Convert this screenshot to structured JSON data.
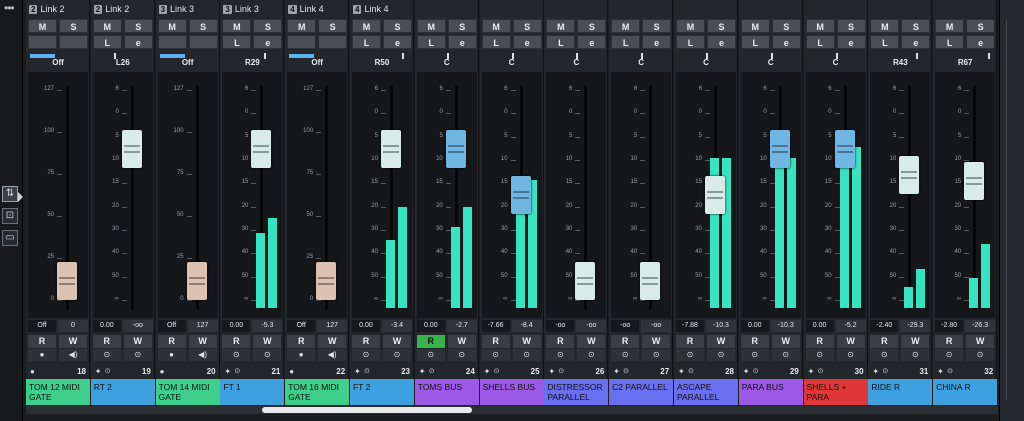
{
  "left_toolbar": {
    "menu_icon": "more-icon",
    "buttons": [
      {
        "icon": "mixer-faders-icon",
        "glyph": "⇅",
        "active": true
      },
      {
        "icon": "inserts-icon",
        "glyph": "⊡",
        "active": false
      },
      {
        "icon": "monitor-icon",
        "glyph": "▭",
        "active": false
      }
    ]
  },
  "colors": {
    "meter": "#35e4c0",
    "pan_bar": "#5cb3f0",
    "read_active": "#38b24a",
    "cap_midi": "#dcc2b1",
    "cap_audio": "#d9ebe6",
    "cap_group": "#6fb6e2"
  },
  "labels": {
    "mute": "M",
    "solo": "S",
    "listen": "L",
    "edit": "e",
    "read": "R",
    "write": "W"
  },
  "scale_midi": [
    "127",
    "100",
    "75",
    "50",
    "25",
    "0"
  ],
  "scale_db": [
    "6",
    "0",
    "5",
    "10",
    "15",
    "20",
    "30",
    "40",
    "50",
    "∞"
  ],
  "channels": [
    {
      "num": "18",
      "link": "2",
      "link_label": "Link 2",
      "buttons": [
        "M",
        "S",
        "",
        ""
      ],
      "pan": "Off",
      "pan_type": "bar",
      "pan_level": 0.9,
      "volume": "Off",
      "peak": "0",
      "fader_level": 0.12,
      "fader_type": "midi",
      "meters": [],
      "read_on": false,
      "name": "TOM 12 MIDI GATE",
      "color": "#3dcf8b",
      "type": "midi"
    },
    {
      "num": "19",
      "link": "2",
      "link_label": "Link 2",
      "buttons": [
        "M",
        "S",
        "L",
        "e"
      ],
      "pan": "L26",
      "pan_type": "tick",
      "pan_level": 0.35,
      "volume": "0.00",
      "peak": "-oo",
      "fader_level": 0.78,
      "fader_type": "audio",
      "meters": [],
      "read_on": false,
      "name": "RT 2",
      "color": "#3ea0df",
      "type": "audio"
    },
    {
      "num": "20",
      "link": "3",
      "link_label": "Link 3",
      "buttons": [
        "M",
        "S",
        "",
        ""
      ],
      "pan": "Off",
      "pan_type": "bar",
      "pan_level": 0.9,
      "volume": "Off",
      "peak": "127",
      "fader_level": 0.12,
      "fader_type": "midi",
      "meters": [],
      "read_on": false,
      "name": "TOM 14 MIDI GATE",
      "color": "#3dcf8b",
      "type": "midi"
    },
    {
      "num": "21",
      "link": "3",
      "link_label": "Link 3",
      "buttons": [
        "M",
        "S",
        "L",
        "e"
      ],
      "pan": "R29",
      "pan_type": "tick",
      "pan_level": 0.7,
      "volume": "0.00",
      "peak": "-5.3",
      "fader_level": 0.78,
      "fader_type": "audio",
      "meters": [
        0.35,
        0.42
      ],
      "read_on": false,
      "name": "FT 1",
      "color": "#3ea0df",
      "type": "audio"
    },
    {
      "num": "22",
      "link": "4",
      "link_label": "Link 4",
      "buttons": [
        "M",
        "S",
        "",
        ""
      ],
      "pan": "Off",
      "pan_type": "bar",
      "pan_level": 0.9,
      "volume": "Off",
      "peak": "127",
      "fader_level": 0.12,
      "fader_type": "midi",
      "meters": [],
      "read_on": false,
      "name": "TOM 16 MIDI GATE",
      "color": "#3dcf8b",
      "type": "midi"
    },
    {
      "num": "23",
      "link": "4",
      "link_label": "Link 4",
      "buttons": [
        "M",
        "S",
        "L",
        "e"
      ],
      "pan": "R50",
      "pan_type": "tick",
      "pan_level": 0.85,
      "volume": "0.00",
      "peak": "-3.4",
      "fader_level": 0.78,
      "fader_type": "audio",
      "meters": [
        0.32,
        0.47
      ],
      "read_on": false,
      "name": "FT 2",
      "color": "#3ea0df",
      "type": "audio"
    },
    {
      "num": "24",
      "link": "",
      "link_label": "",
      "buttons": [
        "M",
        "S",
        "L",
        "e"
      ],
      "pan": "C",
      "pan_type": "tick",
      "pan_level": 0.5,
      "volume": "0.00",
      "peak": "-2.7",
      "fader_level": 0.78,
      "fader_type": "group",
      "meters": [
        0.38,
        0.47
      ],
      "read_on": true,
      "name": "TOMS BUS",
      "color": "#9b59e6",
      "type": "group"
    },
    {
      "num": "25",
      "link": "",
      "link_label": "",
      "buttons": [
        "M",
        "S",
        "L",
        "e"
      ],
      "pan": "C",
      "pan_type": "tick",
      "pan_level": 0.5,
      "volume": "-7.66",
      "peak": "-8.4",
      "fader_level": 0.55,
      "fader_type": "group",
      "meters": [
        0.6,
        0.6
      ],
      "read_on": false,
      "name": "SHELLS BUS",
      "color": "#9b59e6",
      "type": "group"
    },
    {
      "num": "26",
      "link": "",
      "link_label": "",
      "buttons": [
        "M",
        "S",
        "L",
        "e"
      ],
      "pan": "C",
      "pan_type": "tick",
      "pan_level": 0.5,
      "volume": "-oo",
      "peak": "-oo",
      "fader_level": 0.12,
      "fader_type": "audio",
      "meters": [],
      "read_on": false,
      "name": "DISTRESSOR PARALLEL",
      "color": "#6a6ff0",
      "type": "fx"
    },
    {
      "num": "27",
      "link": "",
      "link_label": "",
      "buttons": [
        "M",
        "S",
        "L",
        "e"
      ],
      "pan": "C",
      "pan_type": "tick",
      "pan_level": 0.5,
      "volume": "-oo",
      "peak": "-oo",
      "fader_level": 0.12,
      "fader_type": "audio",
      "meters": [],
      "read_on": false,
      "name": "C2 PARALLEL",
      "color": "#6a6ff0",
      "type": "fx"
    },
    {
      "num": "28",
      "link": "",
      "link_label": "",
      "buttons": [
        "M",
        "S",
        "L",
        "e"
      ],
      "pan": "C",
      "pan_type": "tick",
      "pan_level": 0.5,
      "volume": "-7.88",
      "peak": "-10.3",
      "fader_level": 0.55,
      "fader_type": "audio",
      "meters": [
        0.7,
        0.7
      ],
      "read_on": false,
      "name": "ASCAPE PARALLEL",
      "color": "#6a6ff0",
      "type": "fx"
    },
    {
      "num": "29",
      "link": "",
      "link_label": "",
      "buttons": [
        "M",
        "S",
        "L",
        "e"
      ],
      "pan": "C",
      "pan_type": "tick",
      "pan_level": 0.5,
      "volume": "0.00",
      "peak": "-10.3",
      "fader_level": 0.78,
      "fader_type": "group",
      "meters": [
        0.7,
        0.7
      ],
      "read_on": false,
      "name": "PARA BUS",
      "color": "#9b59e6",
      "type": "group"
    },
    {
      "num": "30",
      "link": "",
      "link_label": "",
      "buttons": [
        "M",
        "S",
        "L",
        "e"
      ],
      "pan": "C",
      "pan_type": "tick",
      "pan_level": 0.5,
      "volume": "0.00",
      "peak": "-5.2",
      "fader_level": 0.78,
      "fader_type": "group",
      "meters": [
        0.75,
        0.75
      ],
      "read_on": false,
      "name": "SHELLS + PARA",
      "color": "#e03838",
      "type": "group"
    },
    {
      "num": "31",
      "link": "",
      "link_label": "",
      "buttons": [
        "M",
        "S",
        "L",
        "e"
      ],
      "pan": "R43",
      "pan_type": "tick",
      "pan_level": 0.78,
      "volume": "-2.40",
      "peak": "-29.3",
      "fader_level": 0.65,
      "fader_type": "audio",
      "meters": [
        0.1,
        0.18
      ],
      "read_on": false,
      "name": "RIDE R",
      "color": "#3ea0df",
      "type": "audio"
    },
    {
      "num": "32",
      "link": "",
      "link_label": "",
      "buttons": [
        "M",
        "S",
        "L",
        "e"
      ],
      "pan": "R67",
      "pan_type": "tick",
      "pan_level": 0.9,
      "volume": "-2.80",
      "peak": "-26.3",
      "fader_level": 0.62,
      "fader_type": "audio",
      "meters": [
        0.14,
        0.3
      ],
      "read_on": false,
      "name": "CHINA R",
      "color": "#3ea0df",
      "type": "audio"
    }
  ]
}
